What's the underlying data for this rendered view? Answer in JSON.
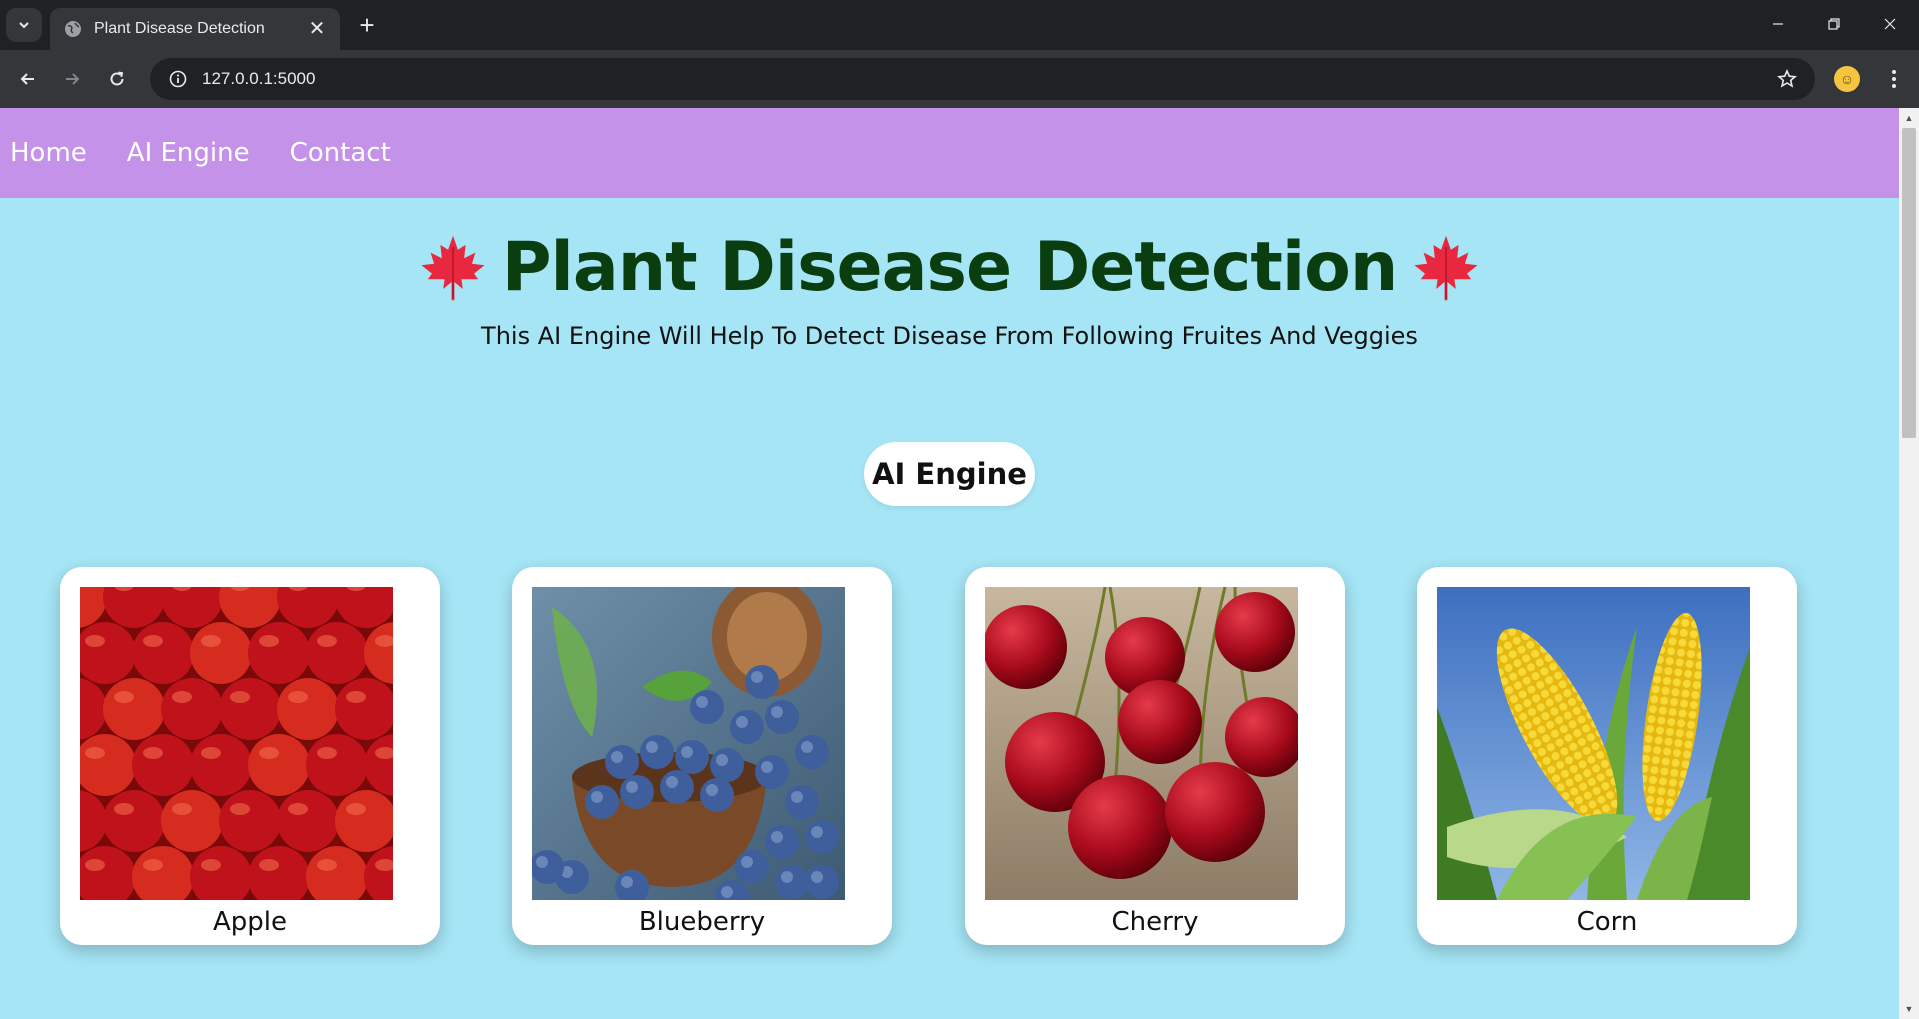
{
  "browser": {
    "tab_title": "Plant Disease Detection",
    "url": "127.0.0.1:5000"
  },
  "nav": {
    "items": [
      "Home",
      "AI Engine",
      "Contact"
    ]
  },
  "hero": {
    "title": "Plant Disease Detection",
    "subtitle": "This AI Engine Will Help To Detect Disease From Following Fruites And Veggies",
    "leaf_icon": "maple-leaf-emoji"
  },
  "section_button": "AI Engine",
  "cards": [
    {
      "label": "Apple",
      "image": "apples-photo"
    },
    {
      "label": "Blueberry",
      "image": "blueberries-photo"
    },
    {
      "label": "Cherry",
      "image": "cherries-photo"
    },
    {
      "label": "Corn",
      "image": "corn-photo"
    }
  ],
  "colors": {
    "nav_bg": "#c592ea",
    "page_bg": "#a5e5f5",
    "title_color": "#0a3d10"
  }
}
